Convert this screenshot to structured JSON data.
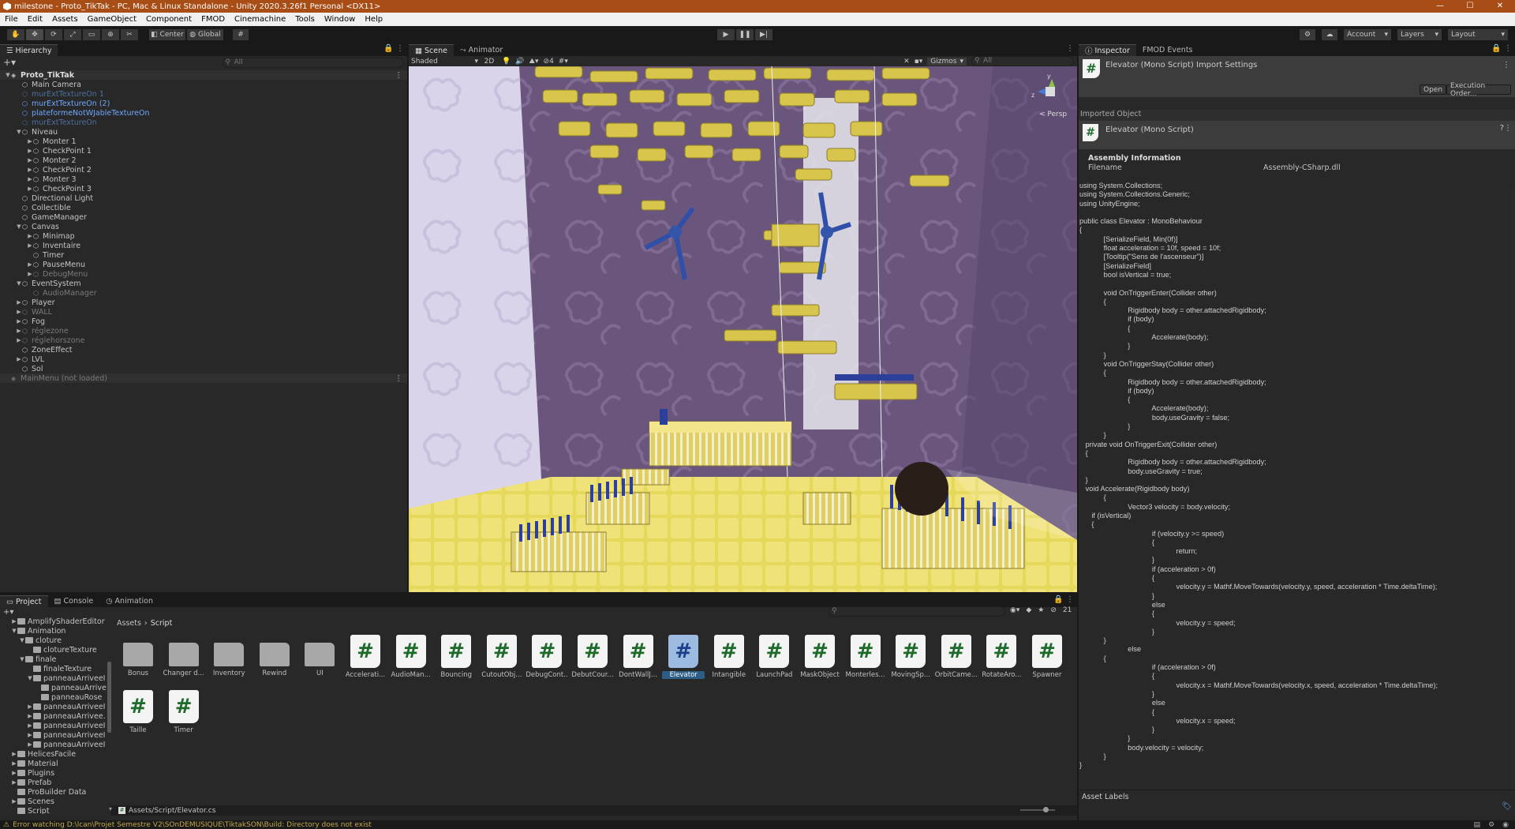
{
  "window": {
    "title": "milestone - Proto_TikTak - PC, Mac & Linux Standalone - Unity 2020.3.26f1 Personal <DX11>",
    "controls": [
      "—",
      "☐",
      "✕"
    ]
  },
  "menu": [
    "File",
    "Edit",
    "Assets",
    "GameObject",
    "Component",
    "FMOD",
    "Cinemachine",
    "Tools",
    "Window",
    "Help"
  ],
  "toolbar": {
    "pivot": "Center",
    "space": "Global",
    "account": "Account",
    "layers": "Layers",
    "layout": "Layout"
  },
  "hierarchy": {
    "tab": "Hierarchy",
    "search_placeholder": "All",
    "scene_name": "Proto_TikTak",
    "rows": [
      {
        "label": "Main Camera",
        "indent": 1,
        "arrow": "",
        "style": "normal"
      },
      {
        "label": "murExtTextureOn 1",
        "indent": 1,
        "arrow": "",
        "style": "blueDim"
      },
      {
        "label": "murExtTextureOn (2)",
        "indent": 1,
        "arrow": "",
        "style": "blue"
      },
      {
        "label": "plateformeNotWJableTextureOn",
        "indent": 1,
        "arrow": "",
        "style": "blue"
      },
      {
        "label": "murExtTextureOn",
        "indent": 1,
        "arrow": "",
        "style": "blueDim"
      },
      {
        "label": "Niveau",
        "indent": 1,
        "arrow": "▼",
        "style": "normal"
      },
      {
        "label": "Monter 1",
        "indent": 2,
        "arrow": "▶",
        "style": "normal"
      },
      {
        "label": "CheckPoint 1",
        "indent": 2,
        "arrow": "▶",
        "style": "normal"
      },
      {
        "label": "Monter 2",
        "indent": 2,
        "arrow": "▶",
        "style": "normal"
      },
      {
        "label": "CheckPoint 2",
        "indent": 2,
        "arrow": "▶",
        "style": "normal"
      },
      {
        "label": "Monter 3",
        "indent": 2,
        "arrow": "▶",
        "style": "normal"
      },
      {
        "label": "CheckPoint 3",
        "indent": 2,
        "arrow": "▶",
        "style": "normal"
      },
      {
        "label": "Directional Light",
        "indent": 1,
        "arrow": "",
        "style": "normal"
      },
      {
        "label": "Collectible",
        "indent": 1,
        "arrow": "",
        "style": "normal"
      },
      {
        "label": "GameManager",
        "indent": 1,
        "arrow": "",
        "style": "normal"
      },
      {
        "label": "Canvas",
        "indent": 1,
        "arrow": "▼",
        "style": "normal"
      },
      {
        "label": "Minimap",
        "indent": 2,
        "arrow": "▶",
        "style": "normal"
      },
      {
        "label": "Inventaire",
        "indent": 2,
        "arrow": "▶",
        "style": "normal"
      },
      {
        "label": "Timer",
        "indent": 2,
        "arrow": "",
        "style": "normal"
      },
      {
        "label": "PauseMenu",
        "indent": 2,
        "arrow": "▶",
        "style": "normal"
      },
      {
        "label": "DebugMenu",
        "indent": 2,
        "arrow": "▶",
        "style": "dim"
      },
      {
        "label": "EventSystem",
        "indent": 1,
        "arrow": "▼",
        "style": "normal"
      },
      {
        "label": "AudioManager",
        "indent": 2,
        "arrow": "",
        "style": "dim"
      },
      {
        "label": "Player",
        "indent": 1,
        "arrow": "▶",
        "style": "normal"
      },
      {
        "label": "WALL",
        "indent": 1,
        "arrow": "▶",
        "style": "dim"
      },
      {
        "label": "Fog",
        "indent": 1,
        "arrow": "▶",
        "style": "normal"
      },
      {
        "label": "réglezone",
        "indent": 1,
        "arrow": "▶",
        "style": "dim"
      },
      {
        "label": "réglehorszone",
        "indent": 1,
        "arrow": "▶",
        "style": "dim"
      },
      {
        "label": "ZoneEffect",
        "indent": 1,
        "arrow": "",
        "style": "normal"
      },
      {
        "label": "LVL",
        "indent": 1,
        "arrow": "▶",
        "style": "normal"
      },
      {
        "label": "Sol",
        "indent": 1,
        "arrow": "",
        "style": "normal"
      }
    ],
    "unloaded_scene": "MainMenu (not loaded)"
  },
  "scene": {
    "tabs": [
      "Scene",
      "Animator"
    ],
    "shading": "Shaded",
    "mode_2d": "2D",
    "hidden_count": "4",
    "gizmos": "Gizmos",
    "search_placeholder": "All",
    "gizmo_axes": {
      "y": "y",
      "z": "z"
    },
    "persp": "< Persp"
  },
  "inspector": {
    "tabs": [
      "Inspector",
      "FMOD Events"
    ],
    "title": "Elevator (Mono Script) Import Settings",
    "open_button": "Open",
    "exec_order_button": "Execution Order...",
    "imported_object": "Imported Object",
    "object_name": "Elevator (Mono Script)",
    "assembly_header": "Assembly Information",
    "filename_label": "Filename",
    "filename_value": "Assembly-CSharp.dll",
    "code": "using System.Collections;\nusing System.Collections.Generic;\nusing UnityEngine;\n\npublic class Elevator : MonoBehaviour\n{\n            [SerializeField, Min(0f)]\n            float acceleration = 10f, speed = 10f;\n            [Tooltip(\"Sens de l'ascenseur\")]\n            [SerializeField]\n            bool isVertical = true;\n\n            void OnTriggerEnter(Collider other)\n            {\n                        Rigidbody body = other.attachedRigidbody;\n                        if (body)\n                        {\n                                    Accelerate(body);\n                        }\n            }\n            void OnTriggerStay(Collider other)\n            {\n                        Rigidbody body = other.attachedRigidbody;\n                        if (body)\n                        {\n                                    Accelerate(body);\n                                    body.useGravity = false;\n                        }\n            }\n   private void OnTriggerExit(Collider other)\n   {\n                        Rigidbody body = other.attachedRigidbody;\n                        body.useGravity = true;\n   }\n   void Accelerate(Rigidbody body)\n            {\n                        Vector3 velocity = body.velocity;\n      if (isVertical)\n      {\n                                    if (velocity.y >= speed)\n                                    {\n                                                return;\n                                    }\n                                    if (acceleration > 0f)\n                                    {\n                                                velocity.y = Mathf.MoveTowards(velocity.y, speed, acceleration * Time.deltaTime);\n                                    }\n                                    else\n                                    {\n                                                velocity.y = speed;\n                                    }\n            }\n                        else\n            {\n                                    if (acceleration > 0f)\n                                    {\n                                                velocity.x = Mathf.MoveTowards(velocity.x, speed, acceleration * Time.deltaTime);\n                                    }\n                                    else\n                                    {\n                                                velocity.x = speed;\n                                    }\n                        }\n                        body.velocity = velocity;\n            }\n}",
    "asset_labels": "Asset Labels"
  },
  "project": {
    "tabs": [
      "Project",
      "Console",
      "Animation"
    ],
    "breadcrumb_root": "Assets",
    "breadcrumb_current": "Script",
    "count": "21",
    "tree": [
      {
        "label": "AmplifyShaderEditor",
        "indent": 1,
        "arrow": "▶"
      },
      {
        "label": "Animation",
        "indent": 1,
        "arrow": "▼"
      },
      {
        "label": "cloture",
        "indent": 2,
        "arrow": "▼"
      },
      {
        "label": "clotureTexture",
        "indent": 3,
        "arrow": ""
      },
      {
        "label": "finale",
        "indent": 2,
        "arrow": "▼"
      },
      {
        "label": "finaleTexture",
        "indent": 3,
        "arrow": ""
      },
      {
        "label": "panneauArriveeI",
        "indent": 3,
        "arrow": "▼"
      },
      {
        "label": "panneauArrive",
        "indent": 4,
        "arrow": ""
      },
      {
        "label": "panneauRose",
        "indent": 4,
        "arrow": ""
      },
      {
        "label": "panneauArriveeI",
        "indent": 3,
        "arrow": "▶"
      },
      {
        "label": "panneauArrivee.",
        "indent": 3,
        "arrow": "▶"
      },
      {
        "label": "panneauArriveeI",
        "indent": 3,
        "arrow": "▶"
      },
      {
        "label": "panneauArriveeI",
        "indent": 3,
        "arrow": "▶"
      },
      {
        "label": "panneauArriveeI",
        "indent": 3,
        "arrow": "▶"
      },
      {
        "label": "HelicesFacile",
        "indent": 1,
        "arrow": "▶"
      },
      {
        "label": "Material",
        "indent": 1,
        "arrow": "▶"
      },
      {
        "label": "Plugins",
        "indent": 1,
        "arrow": "▶"
      },
      {
        "label": "Prefab",
        "indent": 1,
        "arrow": "▶"
      },
      {
        "label": "ProBuilder Data",
        "indent": 1,
        "arrow": ""
      },
      {
        "label": "Scenes",
        "indent": 1,
        "arrow": "▶"
      },
      {
        "label": "Script",
        "indent": 1,
        "arrow": ""
      }
    ],
    "items": [
      {
        "label": "Bonus",
        "kind": "folder"
      },
      {
        "label": "Changer d...",
        "kind": "folder"
      },
      {
        "label": "Inventory",
        "kind": "folder"
      },
      {
        "label": "Rewind",
        "kind": "folder"
      },
      {
        "label": "UI",
        "kind": "folder"
      },
      {
        "label": "Accelerati...",
        "kind": "script"
      },
      {
        "label": "AudioMan...",
        "kind": "script"
      },
      {
        "label": "Bouncing",
        "kind": "script"
      },
      {
        "label": "CutoutObj...",
        "kind": "script"
      },
      {
        "label": "DebugCont...",
        "kind": "script"
      },
      {
        "label": "DebutCour...",
        "kind": "script"
      },
      {
        "label": "DontWallJ...",
        "kind": "script"
      },
      {
        "label": "Elevator",
        "kind": "script",
        "selected": true
      },
      {
        "label": "Intangible",
        "kind": "script"
      },
      {
        "label": "LaunchPad",
        "kind": "script"
      },
      {
        "label": "MaskObject",
        "kind": "script"
      },
      {
        "label": "Monterles...",
        "kind": "script"
      },
      {
        "label": "MovingSp...",
        "kind": "script"
      },
      {
        "label": "OrbitCame...",
        "kind": "script"
      },
      {
        "label": "RotateAro...",
        "kind": "script"
      },
      {
        "label": "Spawner",
        "kind": "script"
      },
      {
        "label": "Taille",
        "kind": "script"
      },
      {
        "label": "Timer",
        "kind": "script"
      }
    ],
    "selected_path": "Assets/Script/Elevator.cs"
  },
  "status": {
    "message": "Error watching D:\\lcan\\Projet Semestre V2\\SOnDEMUSIQUE\\TiktakSON\\Build: Directory does not exist"
  },
  "colors": {
    "title_bar": "#a84d16",
    "selection": "#2c5d87",
    "script_hash": "#1d6b2a",
    "warning": "#c4a94b"
  }
}
